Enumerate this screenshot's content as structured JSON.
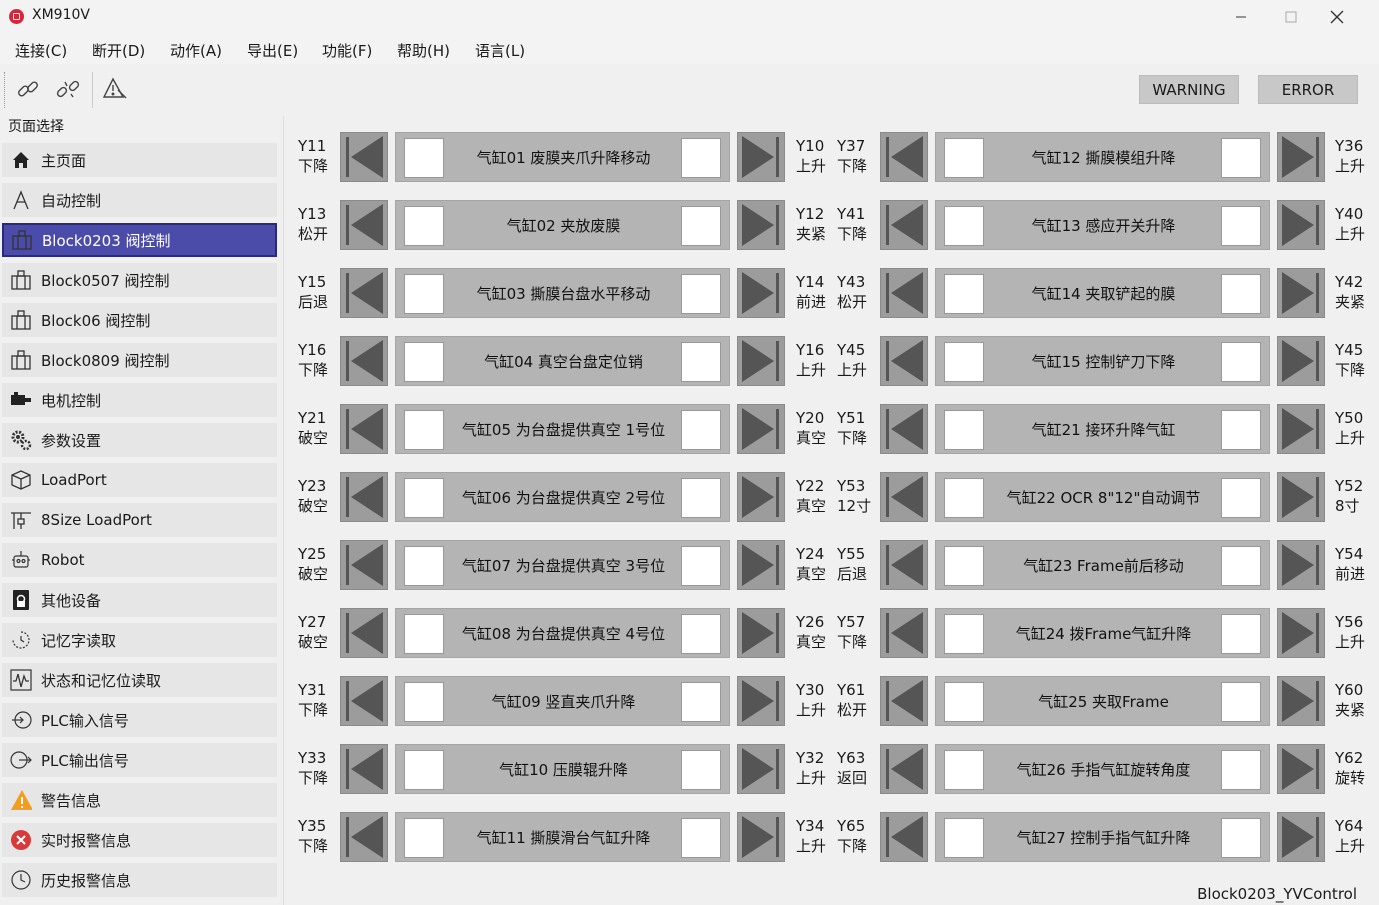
{
  "window": {
    "title": "XM910V"
  },
  "menu": [
    "连接(C)",
    "断开(D)",
    "动作(A)",
    "导出(E)",
    "功能(F)",
    "帮助(H)",
    "语言(L)"
  ],
  "toolbar": {
    "warning_label": "WARNING",
    "error_label": "ERROR"
  },
  "sidebar": {
    "group_label": "页面选择",
    "active_index": 2,
    "items": [
      {
        "label": "主页面",
        "icon": "home-icon"
      },
      {
        "label": "自动控制",
        "icon": "letter-a-icon"
      },
      {
        "label": "Block0203 阀控制",
        "icon": "valve-icon"
      },
      {
        "label": "Block0507 阀控制",
        "icon": "valve-icon"
      },
      {
        "label": "Block06 阀控制",
        "icon": "valve-icon"
      },
      {
        "label": "Block0809 阀控制",
        "icon": "valve-icon"
      },
      {
        "label": "电机控制",
        "icon": "motor-icon"
      },
      {
        "label": "参数设置",
        "icon": "gears-icon"
      },
      {
        "label": "LoadPort",
        "icon": "cube-icon"
      },
      {
        "label": "8Size LoadPort",
        "icon": "crane-icon"
      },
      {
        "label": "Robot",
        "icon": "robot-icon"
      },
      {
        "label": "其他设备",
        "icon": "lock-icon"
      },
      {
        "label": "记忆字读取",
        "icon": "memory-icon"
      },
      {
        "label": "状态和记忆位读取",
        "icon": "waveform-icon"
      },
      {
        "label": "PLC输入信号",
        "icon": "signal-in-icon"
      },
      {
        "label": "PLC输出信号",
        "icon": "signal-out-icon"
      },
      {
        "label": "警告信息",
        "icon": "warning-icon"
      },
      {
        "label": "实时报警信息",
        "icon": "error-icon"
      },
      {
        "label": "历史报警信息",
        "icon": "history-icon"
      }
    ]
  },
  "cylinders_left": [
    {
      "left_port": "Y11",
      "left_action": "下降",
      "name": "气缸01 废膜夹爪升降移动",
      "right_port": "Y10",
      "right_action": "上升"
    },
    {
      "left_port": "Y13",
      "left_action": "松开",
      "name": "气缸02 夹放废膜",
      "right_port": "Y12",
      "right_action": "夹紧"
    },
    {
      "left_port": "Y15",
      "left_action": "后退",
      "name": "气缸03 撕膜台盘水平移动",
      "right_port": "Y14",
      "right_action": "前进"
    },
    {
      "left_port": "Y16",
      "left_action": "下降",
      "name": "气缸04 真空台盘定位销",
      "right_port": "Y16",
      "right_action": "上升"
    },
    {
      "left_port": "Y21",
      "left_action": "破空",
      "name": "气缸05 为台盘提供真空 1号位",
      "right_port": "Y20",
      "right_action": "真空"
    },
    {
      "left_port": "Y23",
      "left_action": "破空",
      "name": "气缸06 为台盘提供真空 2号位",
      "right_port": "Y22",
      "right_action": "真空"
    },
    {
      "left_port": "Y25",
      "left_action": "破空",
      "name": "气缸07 为台盘提供真空 3号位",
      "right_port": "Y24",
      "right_action": "真空"
    },
    {
      "left_port": "Y27",
      "left_action": "破空",
      "name": "气缸08 为台盘提供真空 4号位",
      "right_port": "Y26",
      "right_action": "真空"
    },
    {
      "left_port": "Y31",
      "left_action": "下降",
      "name": "气缸09 竖直夹爪升降",
      "right_port": "Y30",
      "right_action": "上升"
    },
    {
      "left_port": "Y33",
      "left_action": "下降",
      "name": "气缸10 压膜辊升降",
      "right_port": "Y32",
      "right_action": "上升"
    },
    {
      "left_port": "Y35",
      "left_action": "下降",
      "name": "气缸11 撕膜滑台气缸升降",
      "right_port": "Y34",
      "right_action": "上升"
    }
  ],
  "cylinders_right": [
    {
      "left_port": "Y37",
      "left_action": "下降",
      "name": "气缸12 撕膜模组升降",
      "right_port": "Y36",
      "right_action": "上升"
    },
    {
      "left_port": "Y41",
      "left_action": "下降",
      "name": "气缸13 感应开关升降",
      "right_port": "Y40",
      "right_action": "上升"
    },
    {
      "left_port": "Y43",
      "left_action": "松开",
      "name": "气缸14 夹取铲起的膜",
      "right_port": "Y42",
      "right_action": "夹紧"
    },
    {
      "left_port": "Y45",
      "left_action": "上升",
      "name": "气缸15 控制铲刀下降",
      "right_port": "Y45",
      "right_action": "下降"
    },
    {
      "left_port": "Y51",
      "left_action": "下降",
      "name": "气缸21 接环升降气缸",
      "right_port": "Y50",
      "right_action": "上升"
    },
    {
      "left_port": "Y53",
      "left_action": "12寸",
      "name": "气缸22 OCR 8\"12\"自动调节",
      "right_port": "Y52",
      "right_action": "8寸"
    },
    {
      "left_port": "Y55",
      "left_action": "后退",
      "name": "气缸23 Frame前后移动",
      "right_port": "Y54",
      "right_action": "前进"
    },
    {
      "left_port": "Y57",
      "left_action": "下降",
      "name": "气缸24 拨Frame气缸升降",
      "right_port": "Y56",
      "right_action": "上升"
    },
    {
      "left_port": "Y61",
      "left_action": "松开",
      "name": "气缸25 夹取Frame",
      "right_port": "Y60",
      "right_action": "夹紧"
    },
    {
      "left_port": "Y63",
      "left_action": "返回",
      "name": "气缸26 手指气缸旋转角度",
      "right_port": "Y62",
      "right_action": "旋转"
    },
    {
      "left_port": "Y65",
      "left_action": "下降",
      "name": "气缸27 控制手指气缸升降",
      "right_port": "Y64",
      "right_action": "上升"
    }
  ],
  "footer": {
    "status_text": "Block0203_YVControl"
  }
}
